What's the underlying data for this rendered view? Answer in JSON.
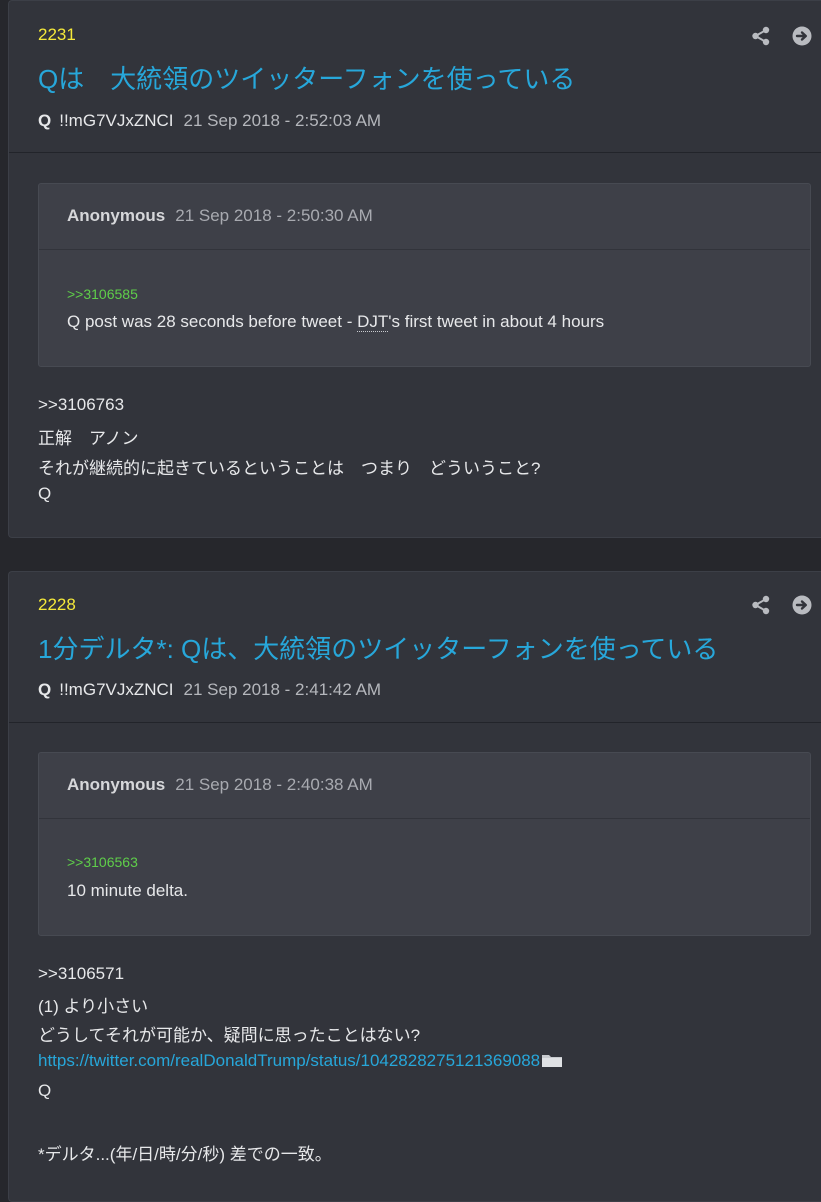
{
  "posts": [
    {
      "number": "2231",
      "title": "Qは　大統領のツイッターフォンを使っている",
      "name": "Q",
      "tripcode": "!!mG7VJxZNCI",
      "date": "21 Sep 2018 - 2:52:03 AM",
      "quote": {
        "name": "Anonymous",
        "date": "21 Sep 2018 - 2:50:30 AM",
        "link": ">>3106585",
        "text_before": "Q post was 28 seconds before tweet - ",
        "abbr": "DJT",
        "text_after": "'s first tweet in about 4 hours"
      },
      "body": [
        ">>3106763",
        "正解　アノン",
        "それが継続的に起きているということは　つまり　どういうこと?",
        "Q"
      ]
    },
    {
      "number": "2228",
      "title": "1分デルタ*: Qは、大統領のツイッターフォンを使っている",
      "name": "Q",
      "tripcode": "!!mG7VJxZNCI",
      "date": "21 Sep 2018 - 2:41:42 AM",
      "quote": {
        "name": "Anonymous",
        "date": "21 Sep 2018 - 2:40:38 AM",
        "link": ">>3106563",
        "text": "10 minute delta."
      },
      "body": [
        ">>3106571",
        "(1) より小さい",
        "どうしてそれが可能か、疑問に思ったことはない?",
        "https://twitter.com/realDonaldTrump/status/1042828275121369088",
        "Q",
        "*デルタ...(年/日/時/分/秒) 差での一致。"
      ]
    }
  ],
  "icons": {
    "share": "share-icon",
    "goto": "arrow-right-circle-icon",
    "attachment": "folder-icon"
  },
  "colors": {
    "post_number": "#f5e93a",
    "title": "#27a7da",
    "reply_link": "#5fce4a",
    "background": "#26272c",
    "post_bg": "#32343b",
    "quote_bg": "#3e4048"
  }
}
